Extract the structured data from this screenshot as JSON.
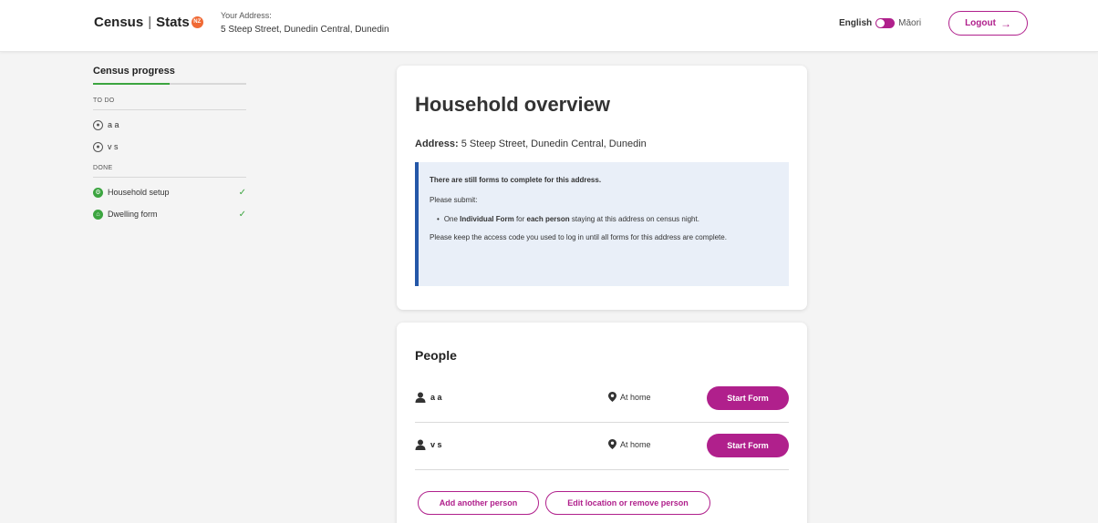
{
  "header": {
    "logo_census": "Census",
    "logo_sep": "|",
    "logo_stats": "Stats",
    "logo_badge": "NZ",
    "address_label": "Your Address:",
    "address_value": "5 Steep Street, Dunedin Central, Dunedin",
    "lang_english": "English",
    "lang_maori": "Māori",
    "logout_label": "Logout",
    "logout_arrow": "→"
  },
  "sidebar": {
    "title": "Census progress",
    "progress_fraction": 0.5,
    "todo_label": "TO DO",
    "todo_items": [
      {
        "label": "a a"
      },
      {
        "label": "v s"
      }
    ],
    "done_label": "DONE",
    "done_items": [
      {
        "label": "Household setup",
        "icon": "gear-icon"
      },
      {
        "label": "Dwelling form",
        "icon": "home-icon"
      }
    ]
  },
  "overview": {
    "title": "Household overview",
    "address_label": "Address:",
    "address_value": "5 Steep Street, Dunedin Central, Dunedin",
    "notice_title": "There are still forms to complete for this address.",
    "notice_submit": "Please submit:",
    "notice_bullet_pre": "One ",
    "notice_bullet_b1": "Individual Form",
    "notice_bullet_mid": " for ",
    "notice_bullet_b2": "each person",
    "notice_bullet_post": " staying at this address on census night.",
    "notice_footer": "Please keep the access code you used to log in until all forms for this address are complete."
  },
  "people": {
    "title": "People",
    "rows": [
      {
        "name": "a a",
        "location": "At home",
        "action": "Start Form"
      },
      {
        "name": "v s",
        "location": "At home",
        "action": "Start Form"
      }
    ],
    "add_label": "Add another person",
    "edit_label": "Edit location or remove person"
  },
  "colors": {
    "accent": "#b0208c",
    "success": "#3ca540",
    "notice_bg": "#e9eff8",
    "notice_border": "#2457a8",
    "badge": "#f06a35"
  }
}
